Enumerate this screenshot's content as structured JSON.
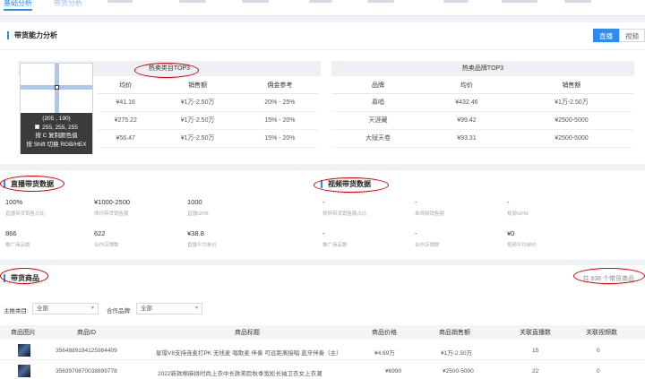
{
  "tabs": [
    {
      "label": "基础分析",
      "active": true
    },
    {
      "label": "带货分析",
      "active": false
    }
  ],
  "ability": {
    "title": "带货能力分析",
    "toggle": {
      "live": "直播",
      "video": "视频"
    },
    "category_panel": {
      "title": "热卖类目TOP3",
      "headers": [
        "均价",
        "销售额",
        "佣金参考"
      ],
      "rows": [
        [
          "¥41.16",
          "¥1万-2.50万",
          "20% - 25%"
        ],
        [
          "¥275.22",
          "¥1万-2.50万",
          "15% - 20%"
        ],
        [
          "¥56.47",
          "¥1万-2.50万",
          "15% - 20%"
        ]
      ]
    },
    "brand_panel": {
      "title": "热卖品牌TOP3",
      "headers": [
        "品牌",
        "均价",
        "销售额"
      ],
      "rows": [
        [
          "慕唱",
          "¥432.46",
          "¥1万-2.50万"
        ],
        [
          "天涯藏",
          "¥99.42",
          "¥2500-5000"
        ],
        [
          "大赋天卷",
          "¥93.31",
          "¥2500-5000"
        ]
      ]
    },
    "picker": {
      "coords": "(205 , 190)",
      "rgb": "255, 255, 255",
      "hint1": "按 C 复制颜色值",
      "hint2": "按 Shift 切换 RGB/HEX"
    }
  },
  "live": {
    "title": "直播带货数据",
    "stats": [
      {
        "value": "100%",
        "label": "直播带货销售占比"
      },
      {
        "value": "¥1000-2500",
        "label": "场均带货销售额"
      },
      {
        "value": "1000",
        "label": "直播GPM"
      },
      {
        "value": "866",
        "label": "推广商品数"
      },
      {
        "value": "622",
        "label": "合作店铺数"
      },
      {
        "value": "¥38.8",
        "label": "直播平均单价"
      }
    ]
  },
  "video": {
    "title": "视频带货数据",
    "stats": [
      {
        "value": "-",
        "label": "视频带货销售额占比"
      },
      {
        "value": "-",
        "label": "单视频销售额"
      },
      {
        "value": "-",
        "label": "视频GPM"
      },
      {
        "value": "-",
        "label": "推广商品数"
      },
      {
        "value": "-",
        "label": "合作店铺数"
      },
      {
        "value": "¥0",
        "label": "视频平均单价"
      }
    ]
  },
  "products": {
    "title": "带货商品",
    "count_text": "共 838 个带货商品",
    "filters": {
      "category_label": "主推类目:",
      "category_value": "全部",
      "brand_label": "合作品牌:",
      "brand_value": "全部"
    },
    "headers": [
      "商品图片",
      "商品ID",
      "商品标题",
      "商品价格",
      "商品销售额",
      "关联直播数",
      "关联视频数"
    ],
    "rows": [
      {
        "id": "3564889194125984409",
        "title": "星璟V8支持连麦打PK 无线麦 唱歌麦 伴奏 可远距离接唱 蓝牙伴奏（主）",
        "price": "¥4.69万",
        "sales": "¥1万-2.50万",
        "lives": "15",
        "videos": "0"
      },
      {
        "id": "3563970870038899778",
        "title": "2022新款棉麻拼时尚上衣中长款笑脸秋季宽松长袖卫衣女上衣潮",
        "price": "¥6990",
        "sales": "¥2500-5000",
        "lives": "22",
        "videos": "0"
      }
    ]
  },
  "colors": {
    "accent": "#2d8cf0",
    "annotation": "#d40000"
  }
}
